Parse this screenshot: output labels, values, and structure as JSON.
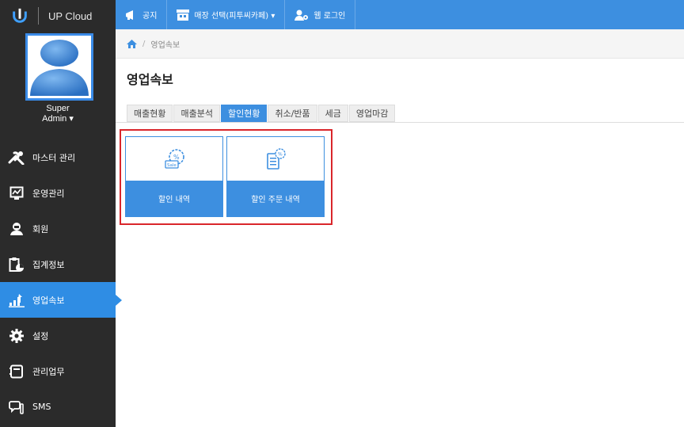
{
  "brand": {
    "name": "UP Cloud"
  },
  "user": {
    "line1": "Super",
    "line2": "Admin ▾"
  },
  "sidebar": {
    "items": [
      {
        "label": "마스터 관리",
        "icon": "tools-icon"
      },
      {
        "label": "운영관리",
        "icon": "monitor-chart-icon"
      },
      {
        "label": "회원",
        "icon": "member-icon"
      },
      {
        "label": "집계정보",
        "icon": "clipboard-chart-icon"
      },
      {
        "label": "영업속보",
        "icon": "bar-chart-icon",
        "active": true
      },
      {
        "label": "설정",
        "icon": "gear-icon"
      },
      {
        "label": "관리업무",
        "icon": "notebook-icon"
      },
      {
        "label": "SMS",
        "icon": "chat-icon"
      }
    ]
  },
  "topbar": {
    "notice": "공지",
    "store_select": "매장 선택(피투씨카페) ▾",
    "web_login": "웹 로그인"
  },
  "breadcrumb": {
    "current": "영업속보"
  },
  "page": {
    "title": "영업속보"
  },
  "tabs": [
    {
      "label": "매출현황"
    },
    {
      "label": "매출분석"
    },
    {
      "label": "할인현황",
      "active": true
    },
    {
      "label": "취소/반품"
    },
    {
      "label": "세금"
    },
    {
      "label": "영업마감"
    }
  ],
  "cards": [
    {
      "label": "할인 내역",
      "icon": "sale-tag-icon"
    },
    {
      "label": "할인 주문 내역",
      "icon": "discount-document-icon"
    }
  ],
  "colors": {
    "accent": "#3d8fe0",
    "sidebar": "#2b2b2b",
    "highlight": "#d9262b"
  }
}
